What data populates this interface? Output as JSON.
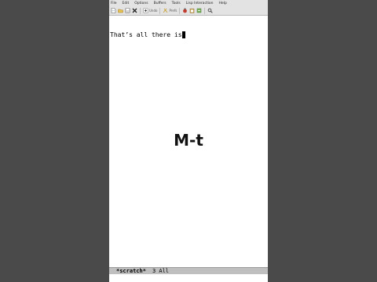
{
  "menubar": {
    "items": [
      "File",
      "Edit",
      "Options",
      "Buffers",
      "Tools",
      "Lisp Interaction",
      "Help"
    ]
  },
  "toolbar": {
    "undo_label": "Undo",
    "prefs_label": "Prefs",
    "icons": [
      "new-file-icon",
      "open-folder-icon",
      "save-icon",
      "close-icon",
      "undo-icon",
      "cut-icon",
      "copy-icon",
      "paste-icon",
      "search-icon"
    ]
  },
  "editor": {
    "line1": "That’s all there is"
  },
  "overlay": {
    "caption": "M-t"
  },
  "modeline": {
    "buffer_name": "*scratch*",
    "position": "3 All"
  },
  "colors": {
    "background": "#4a4a4a",
    "menubar": "#e3e3e3",
    "modeline": "#bfbfbf"
  }
}
